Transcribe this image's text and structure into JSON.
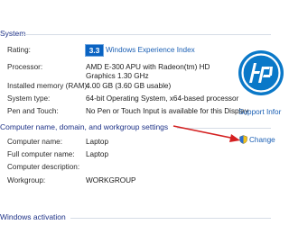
{
  "system": {
    "section_title": "System",
    "rating": {
      "label": "Rating:",
      "score": "3.3",
      "link_text": "Windows Experience Index"
    },
    "processor": {
      "label": "Processor:",
      "value": "AMD E-300 APU with Radeon(tm) HD Graphics   1.30 GHz"
    },
    "memory": {
      "label": "Installed memory (RAM):",
      "value": "4.00 GB (3.60 GB usable)"
    },
    "system_type": {
      "label": "System type:",
      "value": "64-bit Operating System, x64-based processor"
    },
    "pen_touch": {
      "label": "Pen and Touch:",
      "value": "No Pen or Touch Input is available for this Display"
    }
  },
  "oem": {
    "logo_text": "hp",
    "support_link": "Support Infor"
  },
  "computer_name_section": {
    "title": "Computer name, domain, and workgroup settings",
    "change_link": "Change",
    "rows": [
      {
        "label": "Computer name:",
        "value": "Laptop"
      },
      {
        "label": "Full computer name:",
        "value": "Laptop"
      },
      {
        "label": "Computer description:",
        "value": ""
      },
      {
        "label": "Workgroup:",
        "value": "WORKGROUP"
      }
    ]
  },
  "activation": {
    "section_title": "Windows activation"
  },
  "colors": {
    "section_heading": "#1e3287",
    "link": "#1a5fb4",
    "badge": "#0a63c2",
    "hp_logo": "#0a78c8",
    "annotation_arrow": "#d42020"
  },
  "icons": {
    "shield": "uac-shield-icon",
    "arrow": "red-arrow-annotation"
  }
}
